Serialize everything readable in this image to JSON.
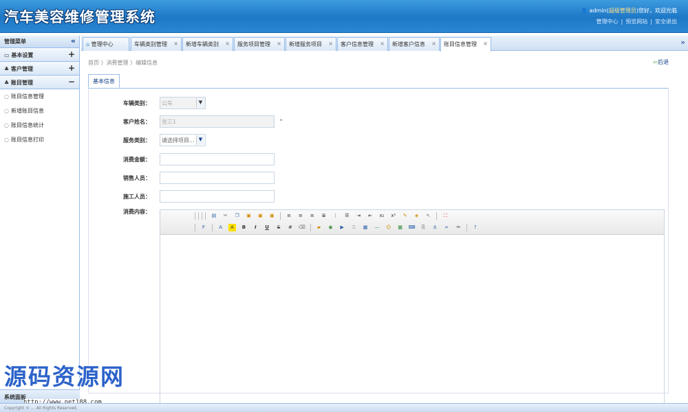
{
  "app": {
    "title": "汽车美容维修管理系统"
  },
  "header": {
    "user_name": "admin",
    "user_role": "超级管理员",
    "greeting_suffix": "您好，欢迎光临",
    "links": [
      "管理中心",
      "预览网站",
      "安全退出"
    ]
  },
  "sidebar": {
    "title": "管理菜单",
    "groups": [
      {
        "label": "基本设置",
        "toggle": "+"
      },
      {
        "label": "客户管理",
        "toggle": "+"
      },
      {
        "label": "账目管理",
        "toggle": "−"
      }
    ],
    "items": [
      "账目信息管理",
      "新增账目信息",
      "账目信息统计",
      "账目信息打印"
    ],
    "bottom_label": "系统面板"
  },
  "tabs": [
    {
      "label": "管理中心"
    },
    {
      "label": "车辆类别管理"
    },
    {
      "label": "新增车辆类别"
    },
    {
      "label": "服务项目管理"
    },
    {
      "label": "新增服务项目"
    },
    {
      "label": "客户信息管理"
    },
    {
      "label": "新增客户信息"
    },
    {
      "label": "账目信息管理"
    }
  ],
  "breadcrumb": "首页 〉消费管理 〉编辑信息",
  "back_label": "后退",
  "form": {
    "tab_label": "基本信息",
    "vehicle_type": {
      "label": "车辆类别：",
      "value": "公车"
    },
    "customer_name": {
      "label": "客户姓名：",
      "value": "张三1",
      "required_mark": "*"
    },
    "service_type": {
      "label": "服务类别：",
      "value": "请选择项目..."
    },
    "amount": {
      "label": "消费金额：",
      "value": ""
    },
    "salesperson": {
      "label": "销售人员：",
      "value": ""
    },
    "worker": {
      "label": "施工人员：",
      "value": ""
    },
    "content": {
      "label": "消费内容："
    }
  },
  "watermark": {
    "text": "源码资源网",
    "url": "http://www.net188.com"
  },
  "footer": {
    "text": "Copyright © ... All Rights Reserved."
  },
  "colors": {
    "header": "#1e78c6",
    "border": "#99bbe8",
    "accent": "#15428b"
  }
}
